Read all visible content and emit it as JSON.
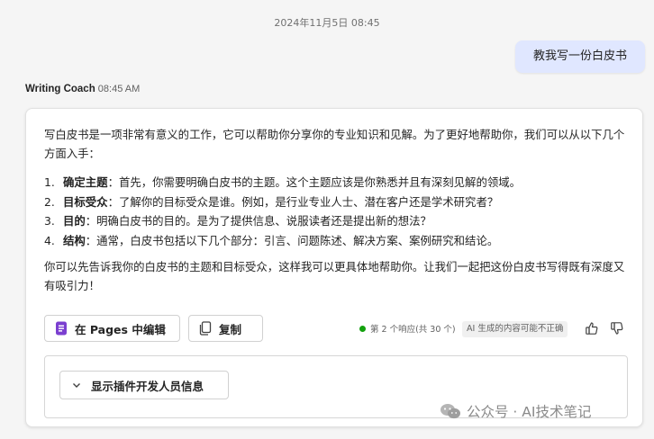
{
  "conversation": {
    "timestamp": "2024年11月5日 08:45",
    "user_message": "教我写一份白皮书"
  },
  "bot": {
    "name": "Writing Coach",
    "time": "08:45 AM",
    "intro": "写白皮书是一项非常有意义的工作，它可以帮助你分享你的专业知识和见解。为了更好地帮助你，我们可以从以下几个方面入手：",
    "steps": [
      {
        "num": "1.",
        "title": "确定主题",
        "text": "：首先，你需要明确白皮书的主题。这个主题应该是你熟悉并且有深刻见解的领域。"
      },
      {
        "num": "2.",
        "title": "目标受众",
        "text": "：了解你的目标受众是谁。例如，是行业专业人士、潜在客户还是学术研究者？"
      },
      {
        "num": "3.",
        "title": "目的",
        "text": "：明确白皮书的目的。是为了提供信息、说服读者还是提出新的想法？"
      },
      {
        "num": "4.",
        "title": "结构",
        "text": "：通常，白皮书包括以下几个部分：引言、问题陈述、解决方案、案例研究和结论。"
      }
    ],
    "outro": "你可以先告诉我你的白皮书的主题和目标受众，这样我可以更具体地帮助你。让我们一起把这份白皮书写得既有深度又有吸引力！"
  },
  "actions": {
    "edit_in_pages": "在 Pages 中编辑",
    "copy": "复制",
    "response_info": "第 2 个响应(共 30 个)",
    "ai_disclaimer": "AI 生成的内容可能不正确",
    "plugin_toggle": "显示插件开发人员信息"
  },
  "watermark": {
    "text": "公众号 · AI技术笔记"
  },
  "colors": {
    "user_bubble": "#e0e7ff",
    "status_dot": "#13a10e",
    "pages_icon": "#7b3fd0"
  }
}
